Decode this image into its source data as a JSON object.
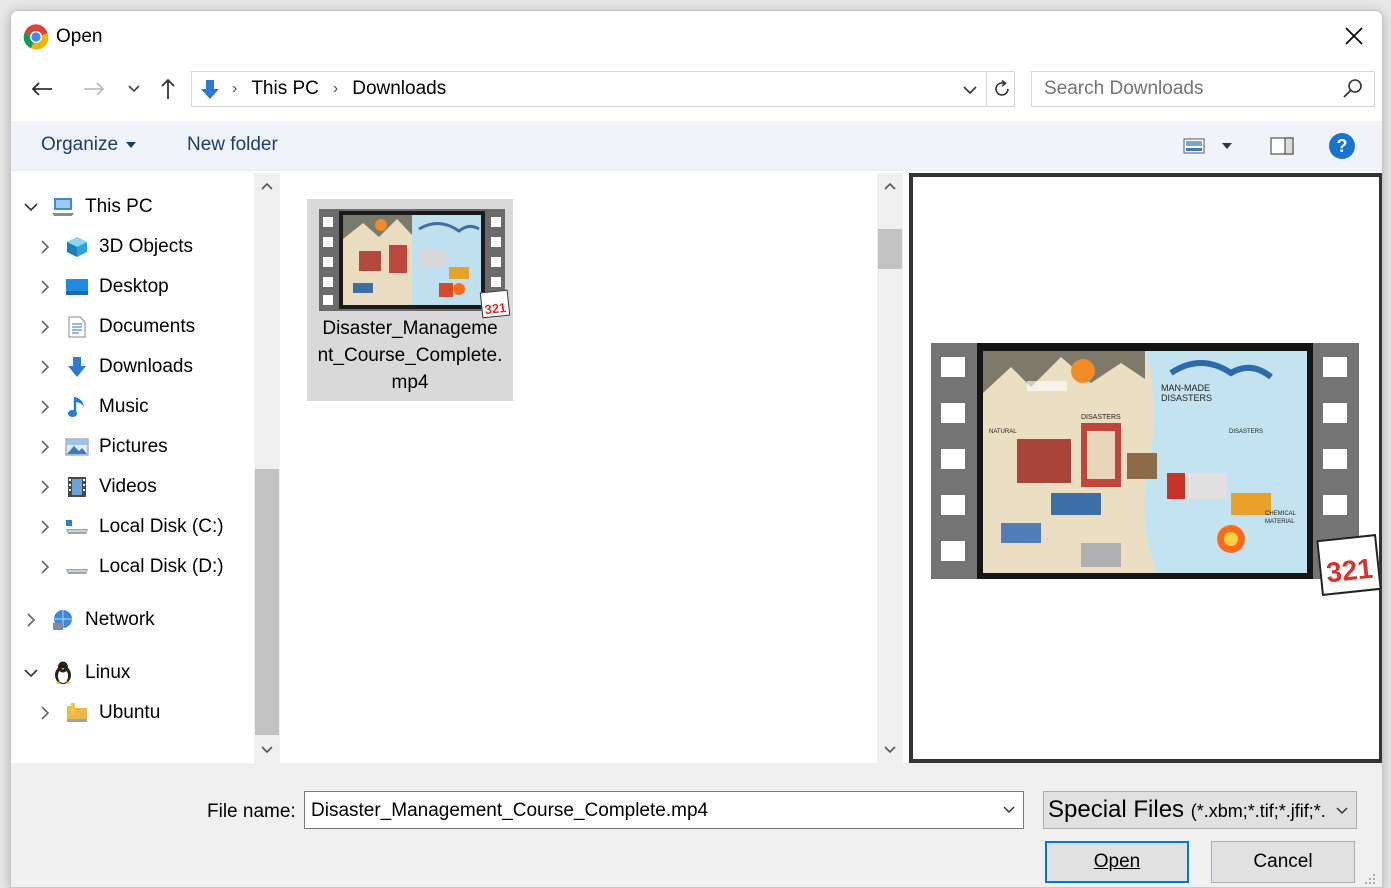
{
  "window": {
    "title": "Open",
    "close_icon": "close-icon",
    "app_icon": "chrome-icon"
  },
  "navigation": {
    "back_icon": "arrow-left-icon",
    "forward_icon": "arrow-right-icon",
    "recent_icon": "chevron-down-icon",
    "up_icon": "arrow-up-icon",
    "breadcrumbs": [
      "This PC",
      "Downloads"
    ],
    "location_icon": "downloads-icon",
    "refresh_icon": "refresh-icon"
  },
  "search": {
    "placeholder": "Search Downloads",
    "icon": "search-icon"
  },
  "toolbar": {
    "organize_label": "Organize",
    "new_folder_label": "New folder",
    "view_icon": "view-options-icon",
    "preview_pane_icon": "preview-pane-icon",
    "help_icon": "help-icon"
  },
  "nav_tree": {
    "items": [
      {
        "label": "This PC",
        "icon": "this-pc-icon",
        "expanded": true,
        "level": 0
      },
      {
        "label": "3D Objects",
        "icon": "3d-objects-icon",
        "expanded": false,
        "level": 1
      },
      {
        "label": "Desktop",
        "icon": "desktop-icon",
        "expanded": false,
        "level": 1
      },
      {
        "label": "Documents",
        "icon": "documents-icon",
        "expanded": false,
        "level": 1
      },
      {
        "label": "Downloads",
        "icon": "downloads-icon",
        "expanded": false,
        "level": 1
      },
      {
        "label": "Music",
        "icon": "music-icon",
        "expanded": false,
        "level": 1
      },
      {
        "label": "Pictures",
        "icon": "pictures-icon",
        "expanded": false,
        "level": 1
      },
      {
        "label": "Videos",
        "icon": "videos-icon",
        "expanded": false,
        "level": 1
      },
      {
        "label": "Local Disk (C:)",
        "icon": "local-disk-c-icon",
        "expanded": false,
        "level": 1
      },
      {
        "label": "Local Disk (D:)",
        "icon": "local-disk-d-icon",
        "expanded": false,
        "level": 1
      },
      {
        "label": "Network",
        "icon": "network-icon",
        "expanded": false,
        "level": 0
      },
      {
        "label": "Linux",
        "icon": "linux-icon",
        "expanded": true,
        "level": 0
      },
      {
        "label": "Ubuntu",
        "icon": "ubuntu-folder-icon",
        "expanded": false,
        "level": 1
      }
    ]
  },
  "files": [
    {
      "name": "Disaster_Management_Course_Complete.mp4",
      "name_lines": [
        "Disaster_Manageme",
        "nt_Course_Complete.",
        "mp4"
      ],
      "selected": true,
      "badge": "321"
    }
  ],
  "preview": {
    "thumbnail_labels": [
      "MAN-MADE",
      "DISASTERS",
      "DISASTERS",
      "NATURAL",
      "DISASTERS",
      "CHEMICAL",
      "MATERIAL"
    ],
    "badge": "321"
  },
  "bottom": {
    "file_name_label": "File name:",
    "file_name_value": "Disaster_Management_Course_Complete.mp4",
    "file_type_main": "Special Files",
    "file_type_pattern": "(*.xbm;*.tif;*.jfif;*.",
    "open_label": "Open",
    "cancel_label": "Cancel"
  },
  "colors": {
    "toolbar_bg": "#f0f4fa",
    "toolbar_text": "#1e3d6b",
    "selection": "#d9d9d9",
    "accent": "#0078d7",
    "help": "#1874cd"
  }
}
